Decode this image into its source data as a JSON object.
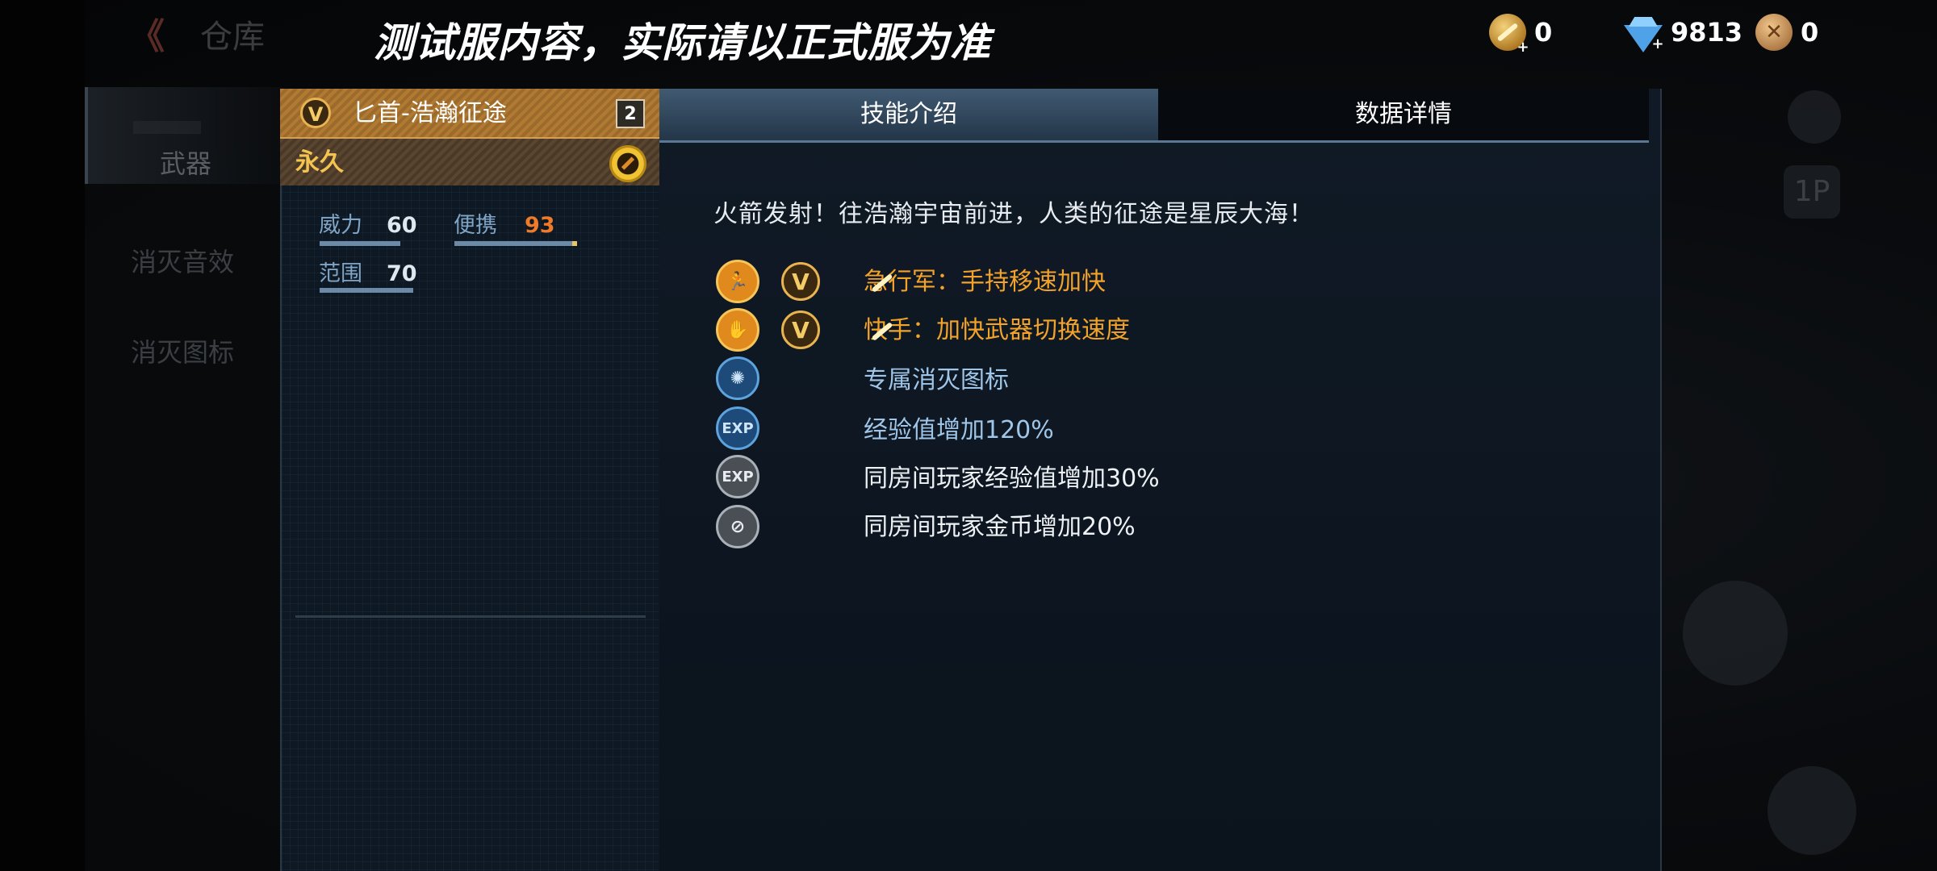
{
  "header": {
    "back_label": "《",
    "page_title": "仓库",
    "notice": "测试服内容，实际请以正式服为准"
  },
  "currencies": [
    {
      "name": "gold-coin",
      "value": "0"
    },
    {
      "name": "diamond",
      "value": "9813"
    },
    {
      "name": "medal",
      "value": "0"
    }
  ],
  "side_nav": {
    "items": [
      {
        "label": "武器",
        "active": true
      },
      {
        "label": "消灭音效",
        "active": false
      },
      {
        "label": "消灭图标",
        "active": false
      }
    ]
  },
  "item": {
    "name": "匕首-浩瀚征途",
    "level": "2",
    "duration": "永久",
    "stats": [
      {
        "label": "威力",
        "value": "60",
        "fill": 0.6
      },
      {
        "label": "便携",
        "value": "93",
        "fill": 0.93
      },
      {
        "label": "范围",
        "value": "70",
        "fill": 0.7
      }
    ]
  },
  "detail": {
    "tabs": [
      {
        "label": "技能介绍",
        "active": true
      },
      {
        "label": "数据详情",
        "active": false
      }
    ],
    "description": "火箭发射！往浩瀚宇宙前进，人类的征途是星辰大海！",
    "perks": [
      {
        "icon": "sprint-icon",
        "badge": "V",
        "text": "急行军：手持移速加快",
        "color": "gold"
      },
      {
        "icon": "quick-hand-icon",
        "badge": "V",
        "text": "快手：加快武器切换速度",
        "color": "gold"
      },
      {
        "icon": "kill-icon-badge",
        "badge": "",
        "text": "专属消灭图标",
        "color": "blue"
      },
      {
        "icon": "exp-icon",
        "badge": "",
        "text": "经验值增加120%",
        "color": "blue"
      },
      {
        "icon": "room-exp-icon",
        "badge": "",
        "text": "同房间玩家经验值增加30%",
        "color": "white"
      },
      {
        "icon": "room-coin-icon",
        "badge": "",
        "text": "同房间玩家金币增加20%",
        "color": "white"
      }
    ]
  },
  "colors": {
    "accent_gold": "#f3a32a",
    "accent_blue": "#9fc6e8",
    "panel_bg": "#0d1823"
  }
}
